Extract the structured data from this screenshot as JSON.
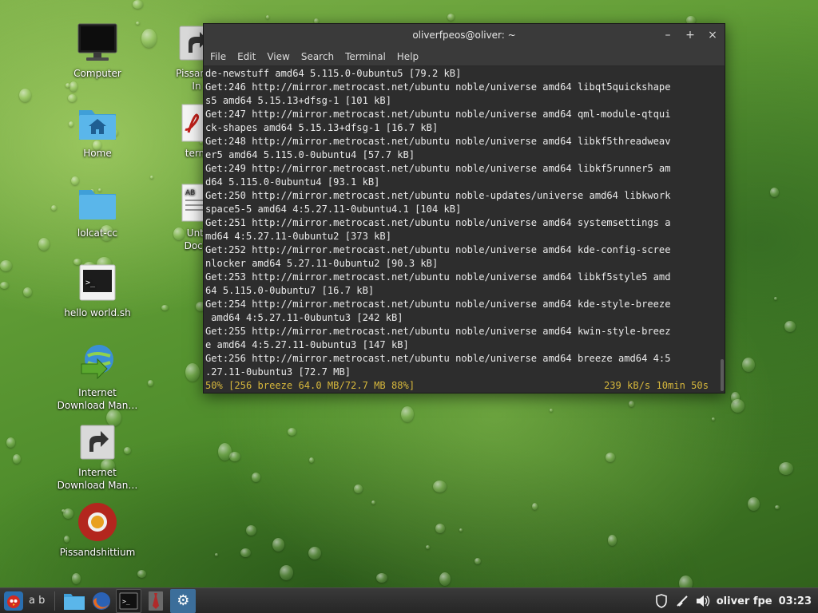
{
  "desktop": {
    "icons": [
      {
        "label": "Computer"
      },
      {
        "label": "Home"
      },
      {
        "label": "lolcat-cc"
      },
      {
        "label": "hello world.sh"
      },
      {
        "label": "Internet\nDownload Man…"
      },
      {
        "label": "Internet\nDownload Man…"
      },
      {
        "label": "Pissandshittium"
      }
    ],
    "icons_col2": [
      {
        "label": "Pissands\nIn"
      },
      {
        "label": "term"
      },
      {
        "label": "Unti\nDocu"
      }
    ]
  },
  "terminal": {
    "title": "oliverfpeos@oliver: ~",
    "menu": [
      "File",
      "Edit",
      "View",
      "Search",
      "Terminal",
      "Help"
    ],
    "lines": [
      "de-newstuff amd64 5.115.0-0ubuntu5 [79.2 kB]",
      "Get:246 http://mirror.metrocast.net/ubuntu noble/universe amd64 libqt5quickshape",
      "s5 amd64 5.15.13+dfsg-1 [101 kB]",
      "Get:247 http://mirror.metrocast.net/ubuntu noble/universe amd64 qml-module-qtqui",
      "ck-shapes amd64 5.15.13+dfsg-1 [16.7 kB]",
      "Get:248 http://mirror.metrocast.net/ubuntu noble/universe amd64 libkf5threadweav",
      "er5 amd64 5.115.0-0ubuntu4 [57.7 kB]",
      "Get:249 http://mirror.metrocast.net/ubuntu noble/universe amd64 libkf5runner5 am",
      "d64 5.115.0-0ubuntu4 [93.1 kB]",
      "Get:250 http://mirror.metrocast.net/ubuntu noble-updates/universe amd64 libkwork",
      "space5-5 amd64 4:5.27.11-0ubuntu4.1 [104 kB]",
      "Get:251 http://mirror.metrocast.net/ubuntu noble/universe amd64 systemsettings a",
      "md64 4:5.27.11-0ubuntu2 [373 kB]",
      "Get:252 http://mirror.metrocast.net/ubuntu noble/universe amd64 kde-config-scree",
      "nlocker amd64 5.27.11-0ubuntu2 [90.3 kB]",
      "Get:253 http://mirror.metrocast.net/ubuntu noble/universe amd64 libkf5style5 amd",
      "64 5.115.0-0ubuntu7 [16.7 kB]",
      "Get:254 http://mirror.metrocast.net/ubuntu noble/universe amd64 kde-style-breeze",
      " amd64 4:5.27.11-0ubuntu3 [242 kB]",
      "Get:255 http://mirror.metrocast.net/ubuntu noble/universe amd64 kwin-style-breez",
      "e amd64 4:5.27.11-0ubuntu3 [147 kB]",
      "Get:256 http://mirror.metrocast.net/ubuntu noble/universe amd64 breeze amd64 4:5",
      ".27.11-0ubuntu3 [72.7 MB]"
    ],
    "progress_left": "50% [256 breeze 64.0 MB/72.7 MB 88%]",
    "progress_right": "239 kB/s 10min 50s"
  },
  "taskbar": {
    "start_text": "a b",
    "tray_text": "oliver fpe",
    "clock": "03:23"
  },
  "colors": {
    "terminal_bg": "#2d2d2d",
    "progress": "#d6b73c"
  }
}
